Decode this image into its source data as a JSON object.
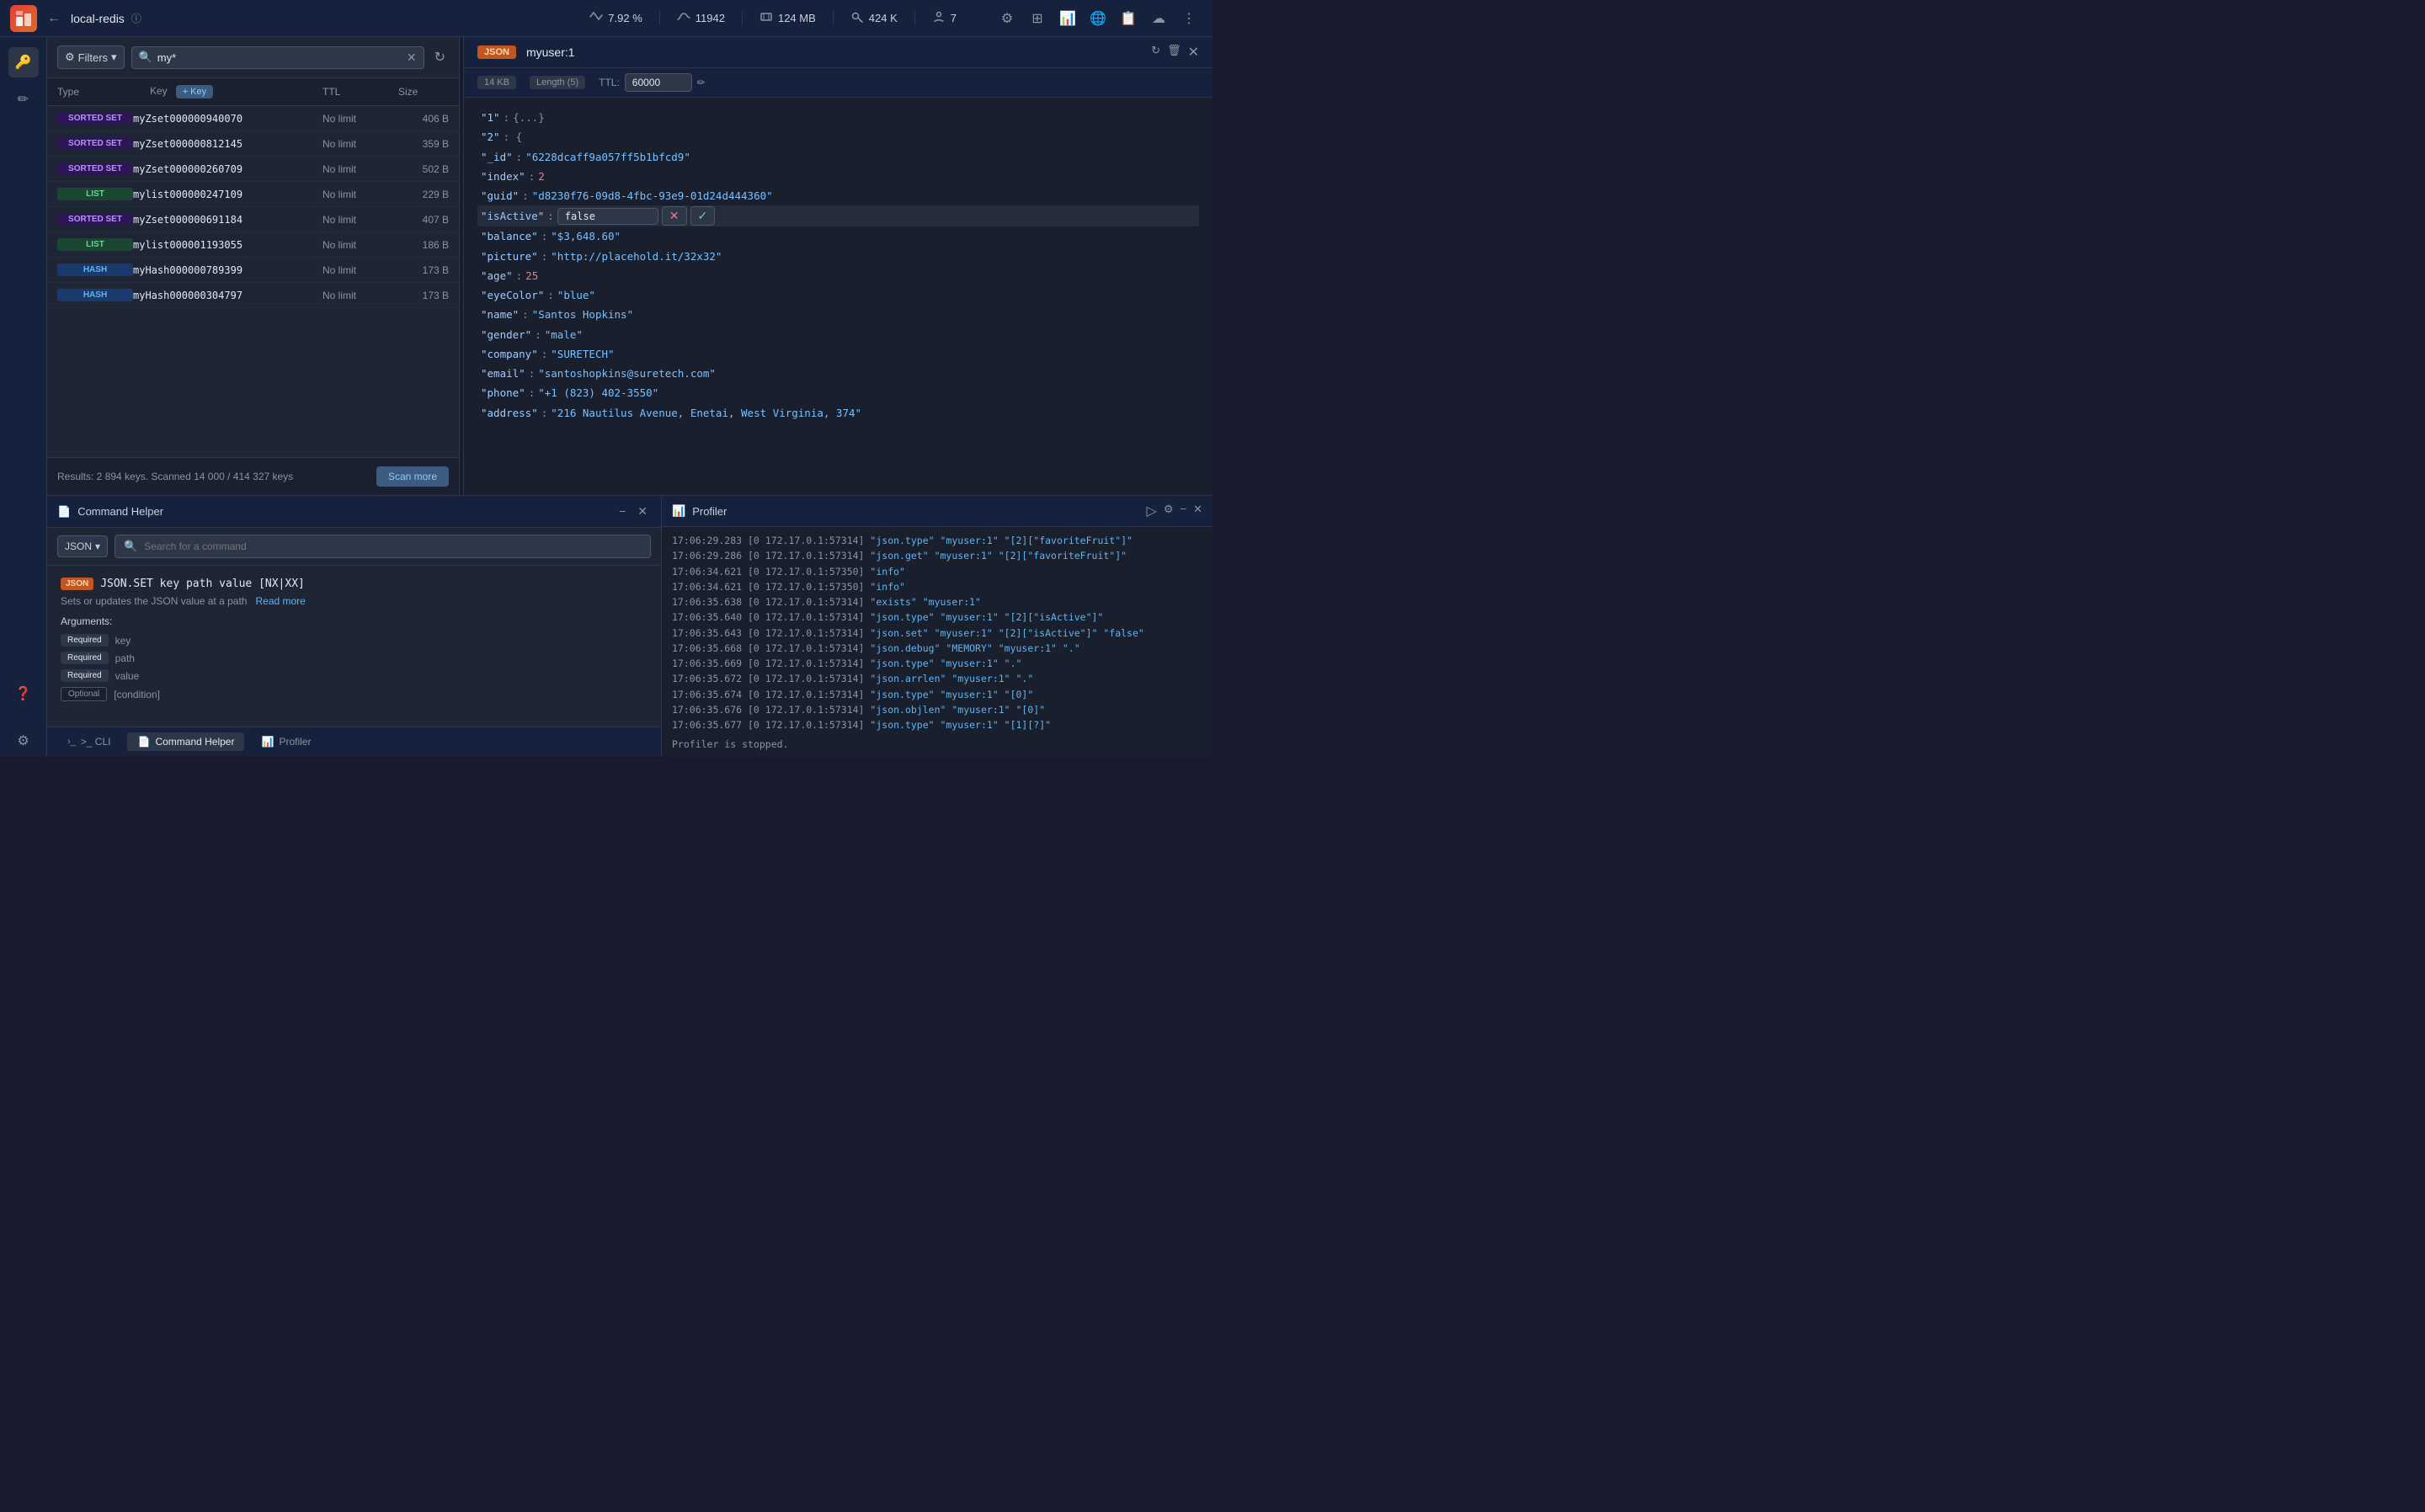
{
  "topbar": {
    "connection": "local-redis",
    "back_label": "←",
    "info_icon": "ℹ",
    "stats": [
      {
        "icon": "⚡",
        "value": "7.92 %",
        "id": "cpu"
      },
      {
        "icon": "↗",
        "value": "11942",
        "id": "ops"
      },
      {
        "icon": "🗃",
        "value": "124 MB",
        "id": "memory"
      },
      {
        "icon": "🔑",
        "value": "424 K",
        "id": "keys"
      },
      {
        "icon": "👤",
        "value": "7",
        "id": "clients"
      }
    ],
    "icons": [
      "⚙",
      "⊞",
      "📊",
      "🌐",
      "📋",
      "☁",
      "⋮"
    ]
  },
  "sidebar_icons": [
    "🔑",
    "✏",
    "❓",
    "⚙"
  ],
  "key_list": {
    "filter_label": "Filters",
    "search_placeholder": "my*",
    "columns": {
      "type": "Type",
      "key": "Key",
      "key_btn": "+ Key",
      "ttl": "TTL",
      "size": "Size"
    },
    "items": [
      {
        "type": "SORTED SET",
        "type_class": "type-sorted-set",
        "name": "myZset000000940070",
        "ttl": "No limit",
        "size": "406 B"
      },
      {
        "type": "SORTED SET",
        "type_class": "type-sorted-set",
        "name": "myZset000000812145",
        "ttl": "No limit",
        "size": "359 B"
      },
      {
        "type": "SORTED SET",
        "type_class": "type-sorted-set",
        "name": "myZset000000260709",
        "ttl": "No limit",
        "size": "502 B"
      },
      {
        "type": "LIST",
        "type_class": "type-list",
        "name": "mylist000000247109",
        "ttl": "No limit",
        "size": "229 B"
      },
      {
        "type": "SORTED SET",
        "type_class": "type-sorted-set",
        "name": "myZset000000691184",
        "ttl": "No limit",
        "size": "407 B"
      },
      {
        "type": "LIST",
        "type_class": "type-list",
        "name": "mylist000001193055",
        "ttl": "No limit",
        "size": "186 B"
      },
      {
        "type": "HASH",
        "type_class": "type-hash",
        "name": "myHash000000789399",
        "ttl": "No limit",
        "size": "173 B"
      },
      {
        "type": "HASH",
        "type_class": "type-hash",
        "name": "myHash000000304797",
        "ttl": "No limit",
        "size": "173 B"
      }
    ],
    "results_text": "Results: 2 894 keys. Scanned 14 000 / 414 327 keys",
    "scan_more": "Scan more"
  },
  "detail": {
    "badge": "JSON",
    "key_name": "myuser:1",
    "meta": {
      "size": "14 KB",
      "length_label": "Length (5)",
      "ttl_label": "TTL:",
      "ttl_value": "60000"
    },
    "json_lines": [
      {
        "indent": 0,
        "content": "\"1\" : {...}",
        "type": "collapsed",
        "actions": [
          "copy",
          "delete"
        ]
      },
      {
        "indent": 0,
        "content": "\"2\" : {",
        "type": "open",
        "actions": [
          "copy",
          "delete"
        ]
      },
      {
        "indent": 1,
        "key": "\"_id\"",
        "value": "\"6228dcaff9a057ff5b1bfcd9\"",
        "value_type": "string",
        "actions": [
          "copy",
          "delete"
        ]
      },
      {
        "indent": 1,
        "key": "\"index\"",
        "value": "2",
        "value_type": "number",
        "actions": [
          "copy",
          "delete"
        ]
      },
      {
        "indent": 1,
        "key": "\"guid\"",
        "value": "\"d8230f76-09d8-4fbc-93e9-01d24d444360\"",
        "value_type": "string",
        "actions": [
          "copy",
          "delete"
        ]
      },
      {
        "indent": 1,
        "key": "\"isActive\"",
        "edit_value": "false",
        "editing": true,
        "actions": [
          "cancel",
          "confirm"
        ]
      },
      {
        "indent": 1,
        "key": "\"balance\"",
        "value": "\"$3,648.60\"",
        "value_type": "string",
        "actions": [
          "copy",
          "delete"
        ]
      },
      {
        "indent": 1,
        "key": "\"picture\"",
        "value": "\"http://placehold.it/32x32\"",
        "value_type": "string",
        "actions": [
          "copy",
          "delete"
        ]
      },
      {
        "indent": 1,
        "key": "\"age\"",
        "value": "25",
        "value_type": "number",
        "actions": [
          "copy",
          "delete"
        ]
      },
      {
        "indent": 1,
        "key": "\"eyeColor\"",
        "value": "\"blue\"",
        "value_type": "string",
        "actions": [
          "copy",
          "delete"
        ]
      },
      {
        "indent": 1,
        "key": "\"name\"",
        "value": "\"Santos Hopkins\"",
        "value_type": "string",
        "actions": [
          "copy",
          "delete"
        ]
      },
      {
        "indent": 1,
        "key": "\"gender\"",
        "value": "\"male\"",
        "value_type": "string",
        "actions": [
          "copy",
          "delete"
        ]
      },
      {
        "indent": 1,
        "key": "\"company\"",
        "value": "\"SURETECH\"",
        "value_type": "string",
        "actions": [
          "copy",
          "delete"
        ]
      },
      {
        "indent": 1,
        "key": "\"email\"",
        "value": "\"santoshopkins@suretech.com\"",
        "value_type": "string",
        "actions": [
          "copy",
          "delete"
        ]
      },
      {
        "indent": 1,
        "key": "\"phone\"",
        "value": "\"+1 (823) 402-3550\"",
        "value_type": "string",
        "actions": [
          "copy",
          "delete"
        ]
      },
      {
        "indent": 1,
        "key": "\"address\"",
        "value": "\"216 Nautilus Avenue, Enetai, West Virginia, 374\"",
        "value_type": "string",
        "actions": [
          "copy",
          "delete"
        ]
      }
    ]
  },
  "cmd_helper": {
    "title": "Command Helper",
    "type_filter": "JSON",
    "search_placeholder": "Search for a command",
    "command": {
      "badge": "JSON",
      "name": "JSON.SET key path value [NX|XX]",
      "desc": "Sets or updates the JSON value at a path",
      "read_more": "Read more",
      "args_title": "Arguments:",
      "args": [
        {
          "badge": "Required",
          "name": "key"
        },
        {
          "badge": "Required",
          "name": "path"
        },
        {
          "badge": "Required",
          "name": "value"
        },
        {
          "badge": "Optional",
          "name": "[condition]"
        }
      ]
    }
  },
  "bottom_tabs": {
    "cli_label": ">_ CLI",
    "cmd_helper_label": "Command Helper",
    "profiler_label": "Profiler"
  },
  "profiler": {
    "title": "Profiler",
    "log_lines": [
      "17:06:29.283 [0 172.17.0.1:57314] \"json.type\" \"myuser:1\" \"[2][\"favoriteFruit\"]\"",
      "17:06:29.286 [0 172.17.0.1:57314] \"json.get\" \"myuser:1\" \"[2][\"favoriteFruit\"]\"",
      "17:06:34.621 [0 172.17.0.1:57350] \"info\"",
      "17:06:34.621 [0 172.17.0.1:57350] \"info\"",
      "17:06:35.638 [0 172.17.0.1:57314] \"exists\" \"myuser:1\"",
      "17:06:35.640 [0 172.17.0.1:57314] \"json.type\" \"myuser:1\" \"[2][\"isActive\"]\"",
      "17:06:35.643 [0 172.17.0.1:57314] \"json.set\" \"myuser:1\" \"[2][\"isActive\"]\" \"false\"",
      "17:06:35.668 [0 172.17.0.1:57314] \"json.debug\" \"MEMORY\" \"myuser:1\" \".\"",
      "17:06:35.669 [0 172.17.0.1:57314] \"json.type\" \"myuser:1\" \".\"",
      "17:06:35.672 [0 172.17.0.1:57314] \"json.arrlen\" \"myuser:1\" \".\"",
      "17:06:35.674 [0 172.17.0.1:57314] \"json.type\" \"myuser:1\" \"[0]\"",
      "17:06:35.676 [0 172.17.0.1:57314] \"json.objlen\" \"myuser:1\" \"[0]\"",
      "17:06:35.677 [0 172.17.0.1:57314] \"json.type\" \"myuser:1\" \"[1][?]\"",
      "Profiler is stopped."
    ]
  }
}
